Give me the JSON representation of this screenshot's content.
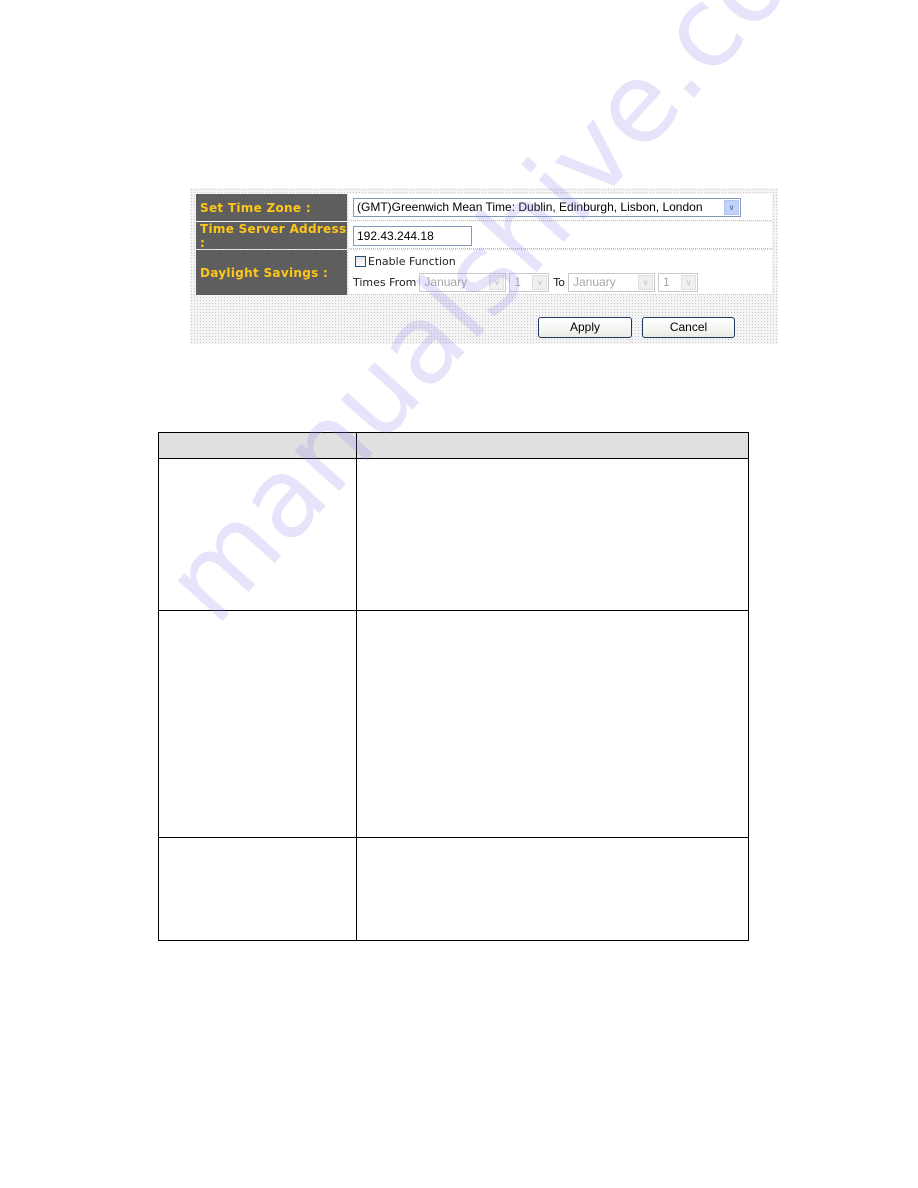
{
  "form": {
    "time_zone": {
      "label": "Set Time Zone :",
      "selected": "(GMT)Greenwich Mean Time: Dublin, Edinburgh, Lisbon, London"
    },
    "time_server": {
      "label": "Time Server Address :",
      "value": "192.43.244.18"
    },
    "daylight_savings": {
      "label": "Daylight Savings :",
      "enable_label": "Enable Function",
      "enabled": false,
      "times_from_label": "Times From",
      "from_month": "January",
      "from_day": "1",
      "to_label": "To",
      "to_month": "January",
      "to_day": "1"
    },
    "apply_label": "Apply",
    "cancel_label": "Cancel"
  },
  "icons": {
    "dropdown_arrow": "∨"
  },
  "table": {
    "headers": [
      "",
      ""
    ],
    "rows": [
      [
        "",
        ""
      ],
      [
        "",
        ""
      ],
      [
        "",
        ""
      ]
    ]
  },
  "watermark": "manualshive.com",
  "colors": {
    "label_bg": "#5e5e5e",
    "label_text": "#ffc61a",
    "header_bg": "#e0e0e0"
  }
}
